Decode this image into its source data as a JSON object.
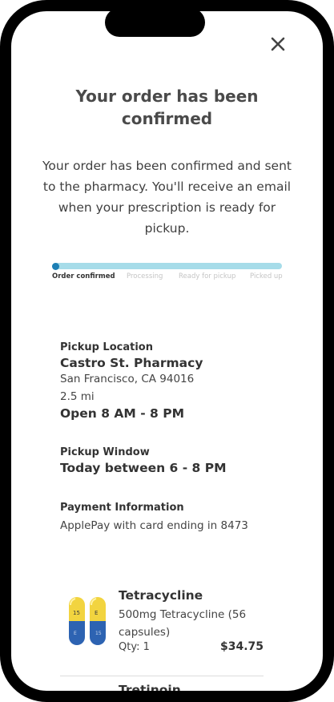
{
  "header": {
    "title": "Your order has been confirmed",
    "message": "Your order has been confirmed and sent to the pharmacy. You'll receive an email when your prescription is ready for pickup."
  },
  "progress": {
    "current_step": 1,
    "total_steps": 4,
    "fill_fraction": 0.0,
    "track_color": "#a6dce9",
    "dot_color": "#1d7fb5",
    "steps": [
      "Order confirmed",
      "Processing",
      "Ready for pickup",
      "Picked up"
    ]
  },
  "pickup": {
    "label": "Pickup Location",
    "name": "Castro St. Pharmacy",
    "address": "San Francisco, CA 94016",
    "distance": "2.5 mi",
    "hours": "Open 8 AM - 8 PM"
  },
  "window": {
    "label": "Pickup Window",
    "value": "Today between 6 - 8 PM"
  },
  "payment": {
    "label": "Payment Information",
    "value": "ApplePay with card ending in 8473"
  },
  "items": [
    {
      "name": "Tetracycline",
      "description": "500mg Tetracycline (56 capsules)",
      "qty": "Qty: 1",
      "price": "$34.75",
      "icon": "capsule-icon"
    },
    {
      "name": "Tretinoin"
    }
  ]
}
